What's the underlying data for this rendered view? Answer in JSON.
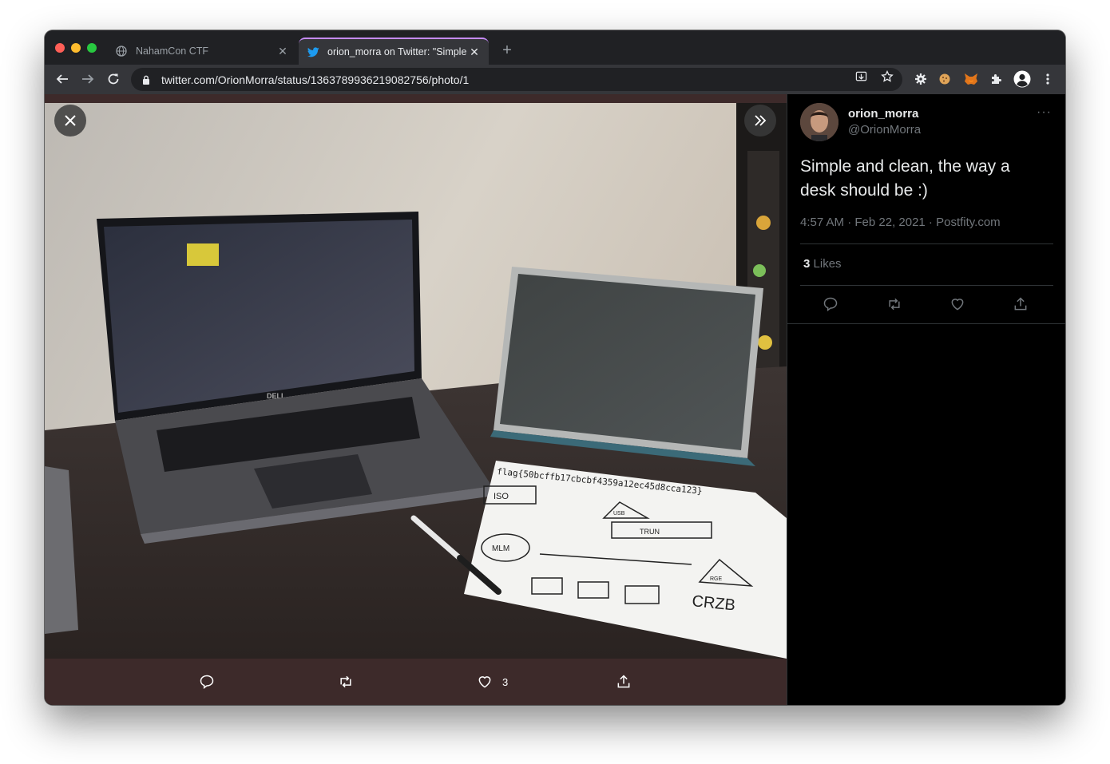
{
  "browser": {
    "tabs": [
      {
        "title": "NahamCon CTF",
        "favicon": "globe-icon",
        "active": false
      },
      {
        "title": "orion_morra on Twitter: \"Simple",
        "favicon": "twitter-bird-icon",
        "active": true
      }
    ],
    "new_tab_label": "+",
    "url": "twitter.com/OrionMorra/status/1363789936219082756/photo/1",
    "extensions": [
      "gear-extension-icon",
      "cookie-extension-icon",
      "metamask-fox-icon",
      "puzzle-extensions-icon",
      "profile-avatar-icon",
      "kebab-menu-icon"
    ],
    "tab_active_accent": "#c58af9"
  },
  "photo_viewer": {
    "actions": {
      "reply_count": "",
      "retweet_count": "",
      "like_count": "3",
      "share_label": ""
    }
  },
  "tweet": {
    "display_name": "orion_morra",
    "handle": "@OrionMorra",
    "text": "Simple and clean, the way a desk should be :)",
    "meta": "4:57 AM · Feb 22, 2021 · Postfity.com",
    "likes_count": "3",
    "likes_label": "Likes",
    "more_label": "···"
  },
  "photo_content": {
    "laptop_brand": "DELL",
    "paper_flag": "flag{50bcffb17cbcbf4359a12ec45d8cca123}",
    "diagram_labels": [
      "ISO",
      "USB",
      "TRUN",
      "MLM",
      "RGE",
      "CRZB"
    ]
  }
}
